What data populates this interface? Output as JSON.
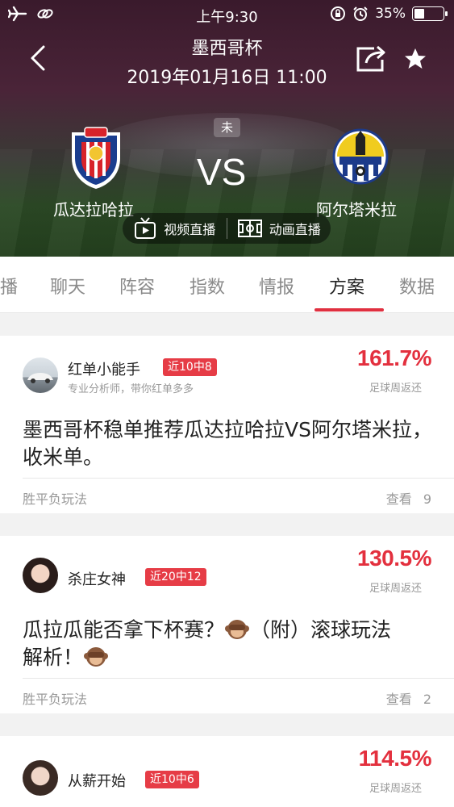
{
  "status_bar": {
    "time": "上午9:30",
    "battery": "35%",
    "battery_fraction": 0.35
  },
  "header": {
    "title": "墨西哥杯",
    "datetime": "2019年01月16日 11:00",
    "match_status": "未",
    "vs": "VS",
    "home_team": "瓜达拉哈拉",
    "away_team": "阿尔塔米拉",
    "video_live": "视频直播",
    "animation_live": "动画直播"
  },
  "tabs": [
    {
      "label": "播"
    },
    {
      "label": "聊天"
    },
    {
      "label": "阵容"
    },
    {
      "label": "指数"
    },
    {
      "label": "情报"
    },
    {
      "label": "方案"
    },
    {
      "label": "数据"
    }
  ],
  "active_tab": "方案",
  "accent_color": "#e3303e",
  "cards": [
    {
      "author": "红单小能手",
      "badge": "近10中8",
      "desc": "专业分析师，带你红单多多",
      "rate": "161.7%",
      "rate_label": "足球周返还",
      "title": "墨西哥杯稳单推荐瓜达拉哈拉VS阿尔塔米拉，收米单。",
      "type": "胜平负玩法",
      "view_label": "查看",
      "view_count": "9"
    },
    {
      "author": "杀庄女神",
      "badge": "近20中12",
      "rate": "130.5%",
      "rate_label": "足球周返还",
      "title_line1": "瓜拉瓜能否拿下杯赛？",
      "title_line1b": "（附）滚球玩法",
      "title_line2": "解析！",
      "type": "胜平负玩法",
      "view_label": "查看",
      "view_count": "2"
    },
    {
      "author": "从薪开始",
      "badge": "近10中6",
      "rate": "114.5%",
      "rate_label": "足球周返还"
    }
  ]
}
